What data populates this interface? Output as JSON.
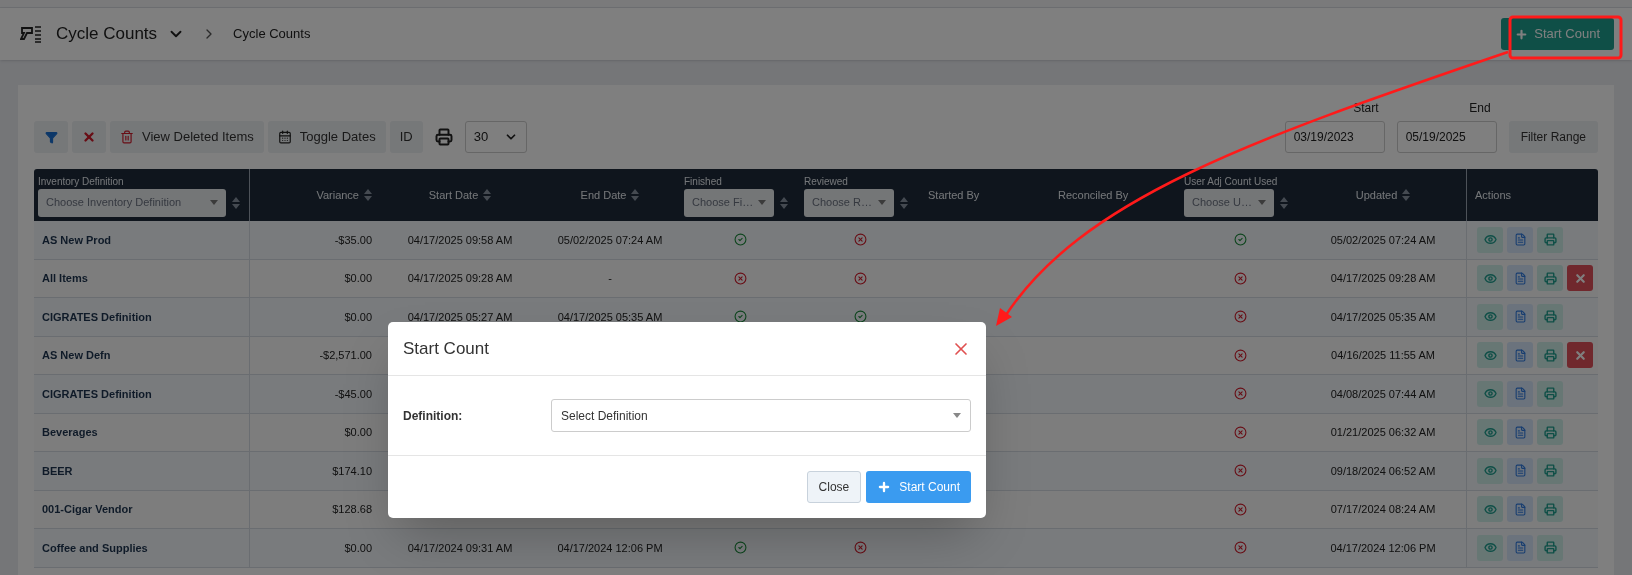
{
  "header": {
    "title": "Cycle Counts",
    "breadcrumb": "Cycle Counts",
    "start_button": "Start Count"
  },
  "toolbar": {
    "deleted_button": "View Deleted Items",
    "dates_button": "Toggle Dates",
    "id_button": "ID",
    "page_size": "30"
  },
  "date_range": {
    "start_label": "Start",
    "start_value": "03/19/2023",
    "end_label": "End",
    "end_value": "05/19/2025",
    "filter_button": "Filter Range"
  },
  "table": {
    "columns": [
      {
        "label": "Inventory Definition",
        "kind": "filter",
        "placeholder": "Choose Inventory Definition"
      },
      {
        "label": "Variance",
        "kind": "sort"
      },
      {
        "label": "Start Date",
        "kind": "sort"
      },
      {
        "label": "End Date",
        "kind": "sort"
      },
      {
        "label": "Finished",
        "kind": "filter",
        "placeholder": "Choose Fi…"
      },
      {
        "label": "Reviewed",
        "kind": "filter",
        "placeholder": "Choose R…"
      },
      {
        "label": "Started By",
        "kind": "plain"
      },
      {
        "label": "Reconciled By",
        "kind": "plain"
      },
      {
        "label": "User Adj Count Used",
        "kind": "filter",
        "placeholder": "Choose U…"
      },
      {
        "label": "Updated",
        "kind": "sort"
      },
      {
        "label": "Actions",
        "kind": "plain"
      }
    ],
    "rows": [
      {
        "name": "AS New Prod",
        "variance": "-$35.00",
        "start_date": "04/17/2025 09:58 AM",
        "end_date": "05/02/2025 07:24 AM",
        "finished": true,
        "reviewed": false,
        "user_adj": true,
        "updated": "05/02/2025 07:24 AM",
        "deletable": false
      },
      {
        "name": "All Items",
        "variance": "$0.00",
        "start_date": "04/17/2025 09:28 AM",
        "end_date": "-",
        "finished": false,
        "reviewed": false,
        "user_adj": false,
        "updated": "04/17/2025 09:28 AM",
        "deletable": true
      },
      {
        "name": "CIGRATES Definition",
        "variance": "$0.00",
        "start_date": "04/17/2025 05:27 AM",
        "end_date": "04/17/2025 05:35 AM",
        "finished": true,
        "reviewed": true,
        "user_adj": false,
        "updated": "04/17/2025 05:35 AM",
        "deletable": false
      },
      {
        "name": "AS New Defn",
        "variance": "-$2,571.00",
        "user_adj": false,
        "updated": "04/16/2025 11:55 AM",
        "deletable": true
      },
      {
        "name": "CIGRATES Definition",
        "variance": "-$45.00",
        "user_adj": false,
        "updated": "04/08/2025 07:44 AM",
        "deletable": false
      },
      {
        "name": "Beverages",
        "variance": "$0.00",
        "user_adj": false,
        "updated": "01/21/2025 06:32 AM",
        "deletable": false
      },
      {
        "name": "BEER",
        "variance": "$174.10",
        "user_adj": false,
        "updated": "09/18/2024 06:52 AM",
        "deletable": false
      },
      {
        "name": "001-Cigar Vendor",
        "variance": "$128.68",
        "user_adj": false,
        "updated": "07/17/2024 08:24 AM",
        "deletable": false
      },
      {
        "name": "Coffee and Supplies",
        "variance": "$0.00",
        "start_date": "04/17/2024 09:31 AM",
        "end_date": "04/17/2024 12:06 PM",
        "finished": true,
        "reviewed": false,
        "user_adj": false,
        "updated": "04/17/2024 12:06 PM",
        "deletable": false
      }
    ]
  },
  "modal": {
    "title": "Start Count",
    "field_label": "Definition:",
    "field_placeholder": "Select Definition",
    "close_button": "Close",
    "submit_button": "Start Count"
  }
}
